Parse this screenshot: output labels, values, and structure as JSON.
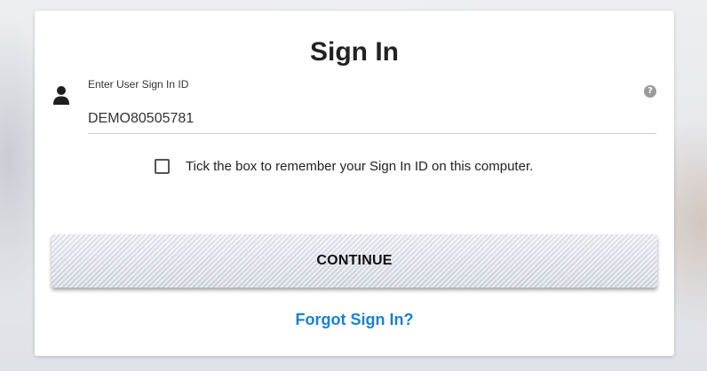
{
  "signin": {
    "title": "Sign In",
    "field_label": "Enter User Sign In ID",
    "user_id_value": "DEMO80505781",
    "help_icon_glyph": "?",
    "remember_label": "Tick the box to remember your Sign In ID on this computer.",
    "remember_checked": false,
    "continue_label": "CONTINUE",
    "forgot_label": "Forgot Sign In?"
  },
  "icons": {
    "user": "user-icon",
    "help": "question-circle-icon"
  },
  "colors": {
    "link": "#1a7fd6",
    "text": "#222222",
    "card_bg": "#ffffff"
  }
}
